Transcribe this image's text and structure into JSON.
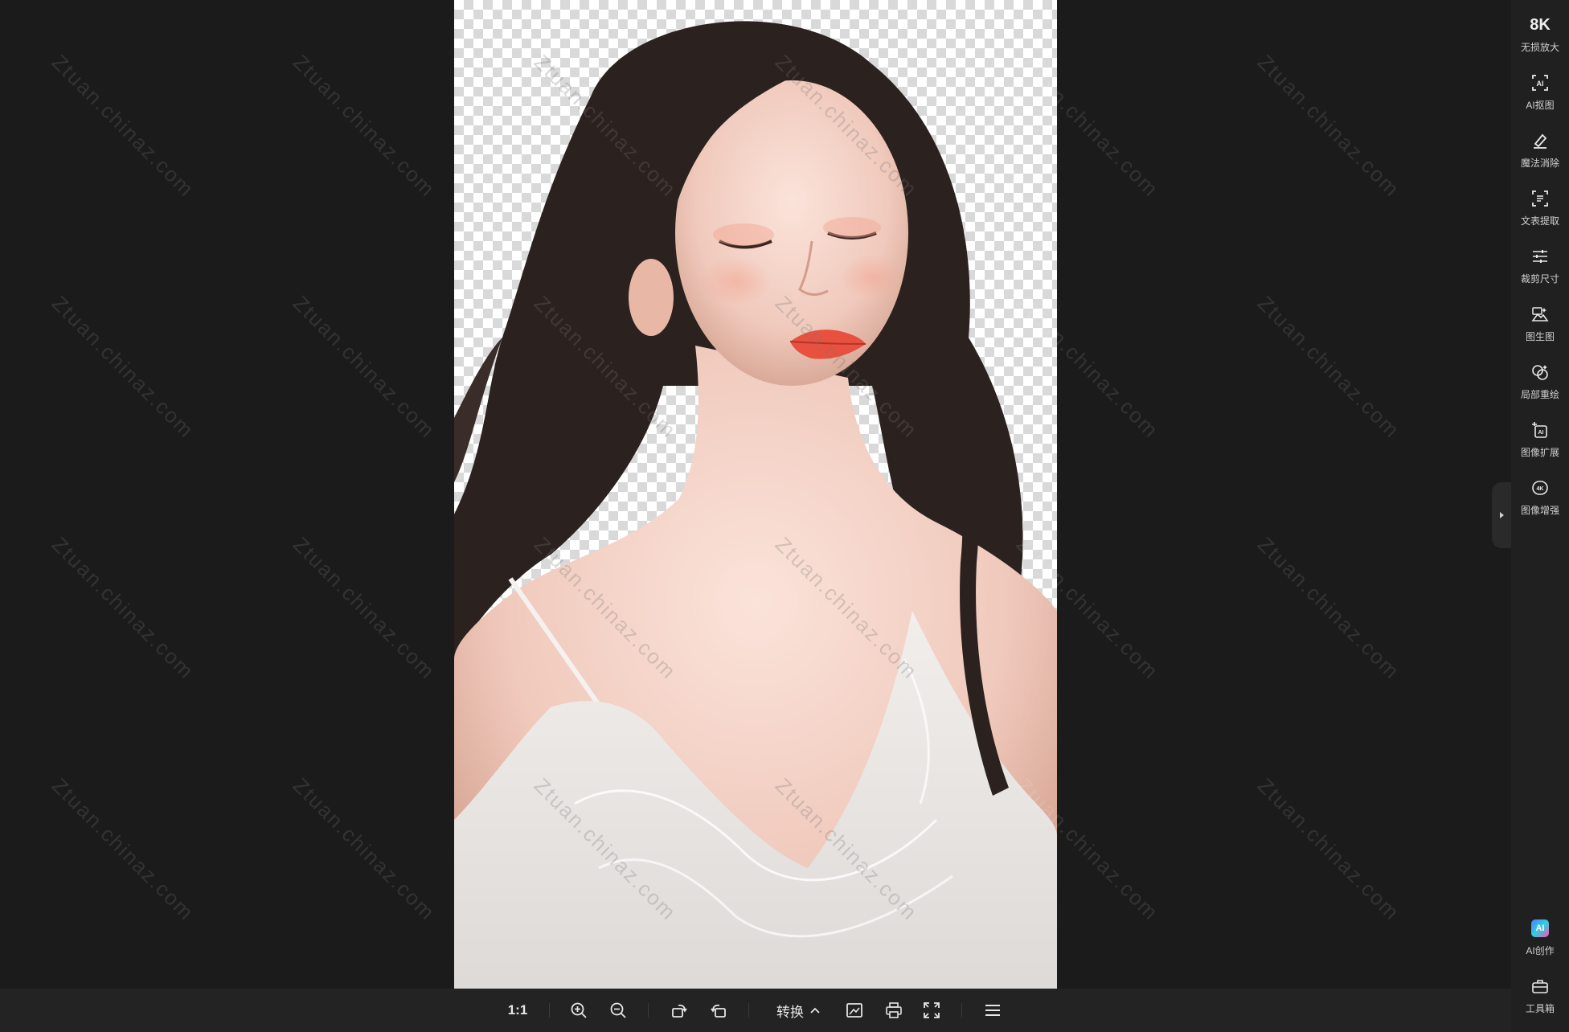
{
  "watermark_text": "Ztuan.chinaz.com",
  "right_toolbar": {
    "items": [
      {
        "icon": "8k-text-icon",
        "icon_text": "8K",
        "label": "无损放大"
      },
      {
        "icon": "ai-cutout-icon",
        "label": "AI抠图"
      },
      {
        "icon": "eraser-icon",
        "label": "魔法消除"
      },
      {
        "icon": "text-scan-icon",
        "label": "文表提取"
      },
      {
        "icon": "sliders-icon",
        "label": "裁剪尺寸"
      },
      {
        "icon": "image-generate-icon",
        "label": "图生图"
      },
      {
        "icon": "repaint-icon",
        "label": "局部重绘"
      },
      {
        "icon": "image-expand-icon",
        "label": "图像扩展"
      },
      {
        "icon": "4k-enhance-icon",
        "label": "图像增强"
      }
    ],
    "ai_create": {
      "badge": "AI",
      "label": "AI创作"
    },
    "toolbox": {
      "label": "工具箱"
    }
  },
  "bottom_toolbar": {
    "actual_size": "1:1",
    "convert_label": "转换"
  },
  "colors": {
    "background": "#1b1b1b",
    "toolbar_bg": "#202020",
    "bottom_bar_bg": "#232323",
    "icon": "#e8e8e8"
  }
}
